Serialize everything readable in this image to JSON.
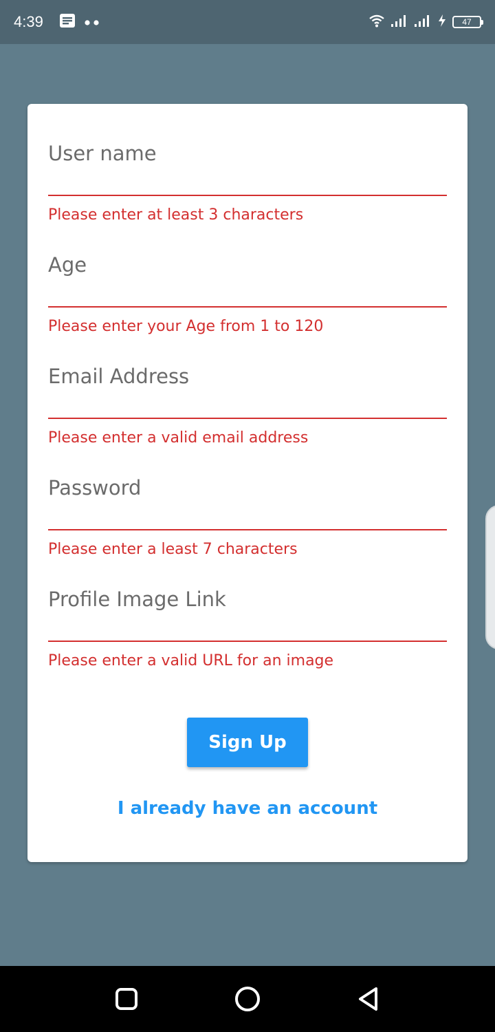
{
  "status_bar": {
    "time": "4:39",
    "battery_level": "47",
    "icons": [
      "notification-icon",
      "more-dots-icon",
      "wifi-icon",
      "signal-icon",
      "signal-icon",
      "charging-icon",
      "battery-icon"
    ]
  },
  "form": {
    "fields": [
      {
        "label": "User name",
        "value": "",
        "error": "Please enter at least 3 characters"
      },
      {
        "label": "Age",
        "value": "",
        "error": "Please enter your Age from 1 to 120"
      },
      {
        "label": "Email Address",
        "value": "",
        "error": "Please enter a valid email address"
      },
      {
        "label": "Password",
        "value": "",
        "error": "Please enter a least 7 characters"
      },
      {
        "label": "Profile Image Link",
        "value": "",
        "error": "Please enter a valid URL for an image"
      }
    ],
    "submit_label": "Sign Up",
    "switch_label": "I already have an account"
  },
  "colors": {
    "background": "#607d8b",
    "status_bar": "#4e6571",
    "error": "#d32f2f",
    "accent": "#2196f3",
    "card": "#ffffff"
  },
  "nav_bar": {
    "icons": [
      "recents-square-icon",
      "home-circle-icon",
      "back-triangle-icon"
    ]
  }
}
